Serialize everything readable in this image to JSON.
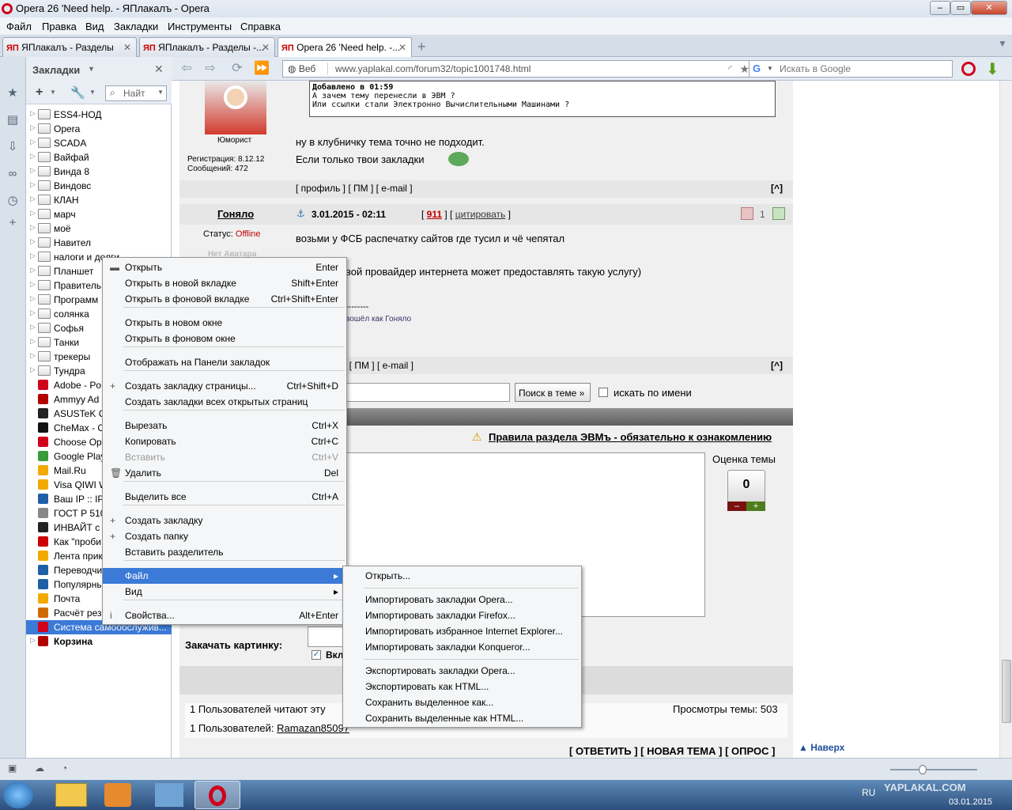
{
  "window": {
    "title": "Opera 26 'Need help. - ЯПлакалъ - Opera"
  },
  "menubar": [
    "Файл",
    "Правка",
    "Вид",
    "Закладки",
    "Инструменты",
    "Справка"
  ],
  "tabs": [
    {
      "label": "ЯПлакалъ - Разделы"
    },
    {
      "label": "ЯПлакалъ - Разделы -..."
    },
    {
      "label": "Opera 26 'Need help. -..."
    }
  ],
  "tab_icon_text": "ЯП",
  "panel": {
    "title": "Закладки",
    "search_placeholder": "Найт",
    "items": [
      "ESS4-НОД",
      "Opera",
      "SCADA",
      "Вайфай",
      "Винда 8",
      "Виндовс",
      "КЛАН",
      "марч",
      "моё",
      "Навител",
      "налоги и долги",
      "Планшет",
      "Правитель",
      "Программ",
      "солянка",
      "Софья",
      "Танки",
      "трекеры",
      "Тундра",
      "Adobe - Po",
      "Ammyy Ad",
      "ASUSTeK C",
      "CheMax - C",
      "Choose Op",
      "Google Play",
      "Mail.Ru",
      "Visa QIWI W",
      "Ваш IP :: IP",
      "ГОСТ Р 510",
      "ИНВАЙТ с",
      "Как \"проби",
      "Лента прик",
      "Переводчи",
      "Популярны",
      "Почта",
      "Расчёт рез",
      "Система самообслужив...",
      "Корзина"
    ]
  },
  "address": {
    "web_label": "Веб",
    "url": "www.yaplakal.com/forum32/topic1001748.html",
    "search_placeholder": "Искать в Google"
  },
  "forum": {
    "quote_title": "Добавлено в 01:59",
    "quote_line1": "А зачем тему перенесли в ЭВМ ?",
    "quote_line2": "Или ссылки стали Электронно Вычислительными Машинами ?",
    "user1_rank": "Юморист",
    "user1_reg": "Регистрация: 8.12.12",
    "user1_msgs": "Сообщений: 472",
    "post1_line1": "ну в клубничку тема точно не подходит.",
    "post1_line2": "Если только твои закладки",
    "links": "[ профиль ] [ ПМ ] [ e-mail ]",
    "top_btn": "[^]",
    "user2_name": "Гоняло",
    "post2_date": "3.01.2015 - 02:11",
    "post2_num": "911",
    "post2_cite": "цитировать",
    "post2_rating": "1",
    "user2_status_label": "Статус:",
    "user2_status": "Offline",
    "user2_noavatar": "Нет Аватара",
    "post2_line1": "возьми у ФСБ распечатку сайтов где тусил и чё чепятал",
    "post2_line2": "вой провайдер интернета может предоставлять такую услугу)",
    "post2_sig_dash": "--------",
    "post2_sig": "вошёл как Гоняло",
    "links2": "] [ ПМ ] [ e-mail ]",
    "search_btn": "Поиск в теме »",
    "search_by_name": "искать по имени",
    "rules": "Правила раздела ЭВМъ - обязательно к ознакомлению",
    "rating_label": "Оценка темы",
    "rating_value": "0",
    "upload_label": "Закачать картинку:",
    "upload_check": "Вкл",
    "readers": "1 Пользователей читают эту",
    "views": "Просмотры темы: 503",
    "users_label": "1 Пользователей:",
    "users_name": "Ramazan85097",
    "actions": "[ ОТВЕТИТЬ ] [ НОВАЯ ТЕМА ] [ ОПРОС ]",
    "up": "Наверх"
  },
  "context_menu": [
    {
      "label": "Открыть",
      "shortcut": "Enter",
      "icon": "folder-open-icon"
    },
    {
      "label": "Открыть в новой вкладке",
      "shortcut": "Shift+Enter"
    },
    {
      "label": "Открыть в фоновой вкладке",
      "shortcut": "Ctrl+Shift+Enter"
    },
    {
      "label": "Открыть в новом окне",
      "shortcut": ""
    },
    {
      "label": "Открыть в фоновом окне",
      "shortcut": ""
    },
    {
      "label": "Отображать на Панели закладок",
      "shortcut": ""
    },
    {
      "label": "Создать закладку страницы...",
      "shortcut": "Ctrl+Shift+D"
    },
    {
      "label": "Создать закладки всех открытых страниц",
      "shortcut": ""
    },
    {
      "label": "Вырезать",
      "shortcut": "Ctrl+X"
    },
    {
      "label": "Копировать",
      "shortcut": "Ctrl+C"
    },
    {
      "label": "Вставить",
      "shortcut": "Ctrl+V"
    },
    {
      "label": "Удалить",
      "shortcut": "Del"
    },
    {
      "label": "Выделить все",
      "shortcut": "Ctrl+A"
    },
    {
      "label": "Создать закладку",
      "shortcut": ""
    },
    {
      "label": "Создать папку",
      "shortcut": ""
    },
    {
      "label": "Вставить разделитель",
      "shortcut": ""
    },
    {
      "label": "Файл",
      "shortcut": ""
    },
    {
      "label": "Вид",
      "shortcut": ""
    },
    {
      "label": "Свойства...",
      "shortcut": "Alt+Enter"
    }
  ],
  "submenu": [
    "Открыть...",
    "Импортировать закладки Opera...",
    "Импортировать закладки Firefox...",
    "Импортировать избранное Internet Explorer...",
    "Импортировать закладки Konqueror...",
    "Экспортировать закладки Opera...",
    "Экспортировать как HTML...",
    "Сохранить выделенное как...",
    "Сохранить выделенные как HTML..."
  ],
  "taskbar": {
    "lang": "RU",
    "date": "03.01.2015",
    "watermark": "YAPLAKAL.COM"
  },
  "colors": {
    "accent": "#3b7ad6",
    "opera_red": "#d0021b",
    "link_red": "#c00000"
  }
}
